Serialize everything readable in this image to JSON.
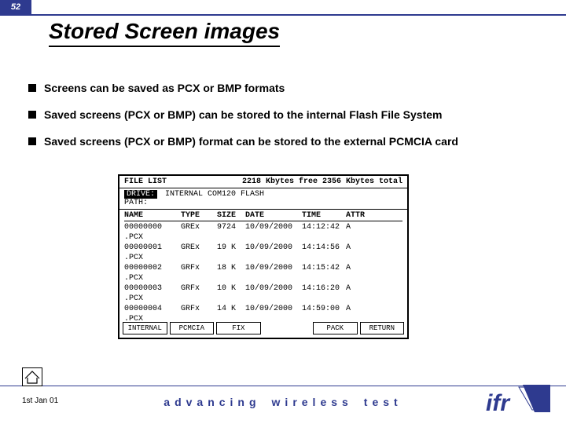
{
  "page_number": "52",
  "title": "Stored Screen images",
  "bullets": [
    "Screens can be saved as PCX or BMP formats",
    "Saved screens (PCX or BMP) can  be stored to the internal Flash File System",
    "Saved screens (PCX or BMP) format can be stored to the external PCMCIA card"
  ],
  "file_list": {
    "header_left": "FILE LIST",
    "header_right": "2218 Kbytes free 2356 Kbytes total",
    "drive_label": "DRIVE:",
    "drive_value": "INTERNAL  COM120 FLASH",
    "path_label": "PATH:",
    "columns": [
      "NAME",
      "TYPE",
      "SIZE",
      "DATE",
      "TIME",
      "ATTR"
    ],
    "rows": [
      {
        "name": "00000000 .PCX",
        "type": "GREx",
        "size": "9724",
        "date": "10/09/2000",
        "time": "14:12:42",
        "attr": "A"
      },
      {
        "name": "00000001 .PCX",
        "type": "GREx",
        "size": "19 K",
        "date": "10/09/2000",
        "time": "14:14:56",
        "attr": "A"
      },
      {
        "name": "00000002 .PCX",
        "type": "GRFx",
        "size": "18 K",
        "date": "10/09/2000",
        "time": "14:15:42",
        "attr": "A"
      },
      {
        "name": "00000003 .PCX",
        "type": "GRFx",
        "size": "10 K",
        "date": "10/09/2000",
        "time": "14:16:20",
        "attr": "A"
      },
      {
        "name": "00000004 .PCX",
        "type": "GRFx",
        "size": "14 K",
        "date": "10/09/2000",
        "time": "14:59:00",
        "attr": "A"
      }
    ],
    "softkeys": [
      "INTERNAL",
      "PCMCIA",
      "FIX",
      "PACK",
      "RETURN"
    ]
  },
  "footer": {
    "date": "1st Jan 01",
    "tagline_words": [
      "advancing",
      "wireless",
      "test"
    ],
    "brand": "ifr"
  },
  "colors": {
    "brand_blue": "#2e3a8f"
  }
}
